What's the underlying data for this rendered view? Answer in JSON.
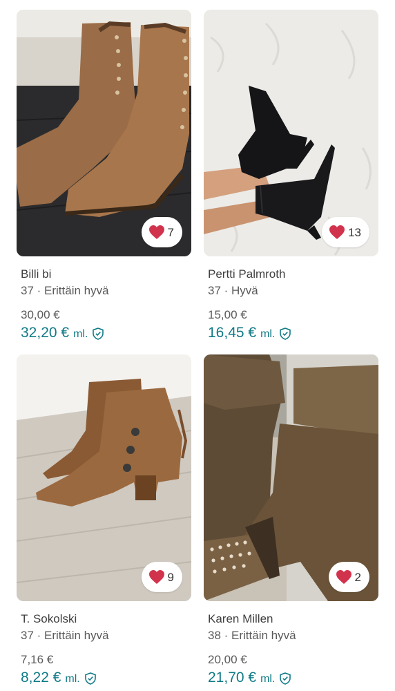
{
  "listings": [
    {
      "brand": "Billi bi",
      "size_condition": "37 · Erittäin hyvä",
      "price": "30,00 €",
      "total_price": "32,20 €",
      "total_suffix": "ml.",
      "favorites": "7",
      "image": "brown suede ankle boots with eyelet lacing"
    },
    {
      "brand": "Pertti Palmroth",
      "size_condition": "37 · Hyvä",
      "price": "15,00 €",
      "total_price": "16,45 €",
      "total_suffix": "ml.",
      "favorites": "13",
      "image": "black suede stiletto ankle boots worn on legs"
    },
    {
      "brand": "T. Sokolski",
      "size_condition": "37 · Erittäin hyvä",
      "price": "7,16 €",
      "total_price": "8,22 €",
      "total_suffix": "ml.",
      "favorites": "9",
      "image": "tan suede ankle boots with buttons"
    },
    {
      "brand": "Karen Millen",
      "size_condition": "38 · Erittäin hyvä",
      "price": "20,00 €",
      "total_price": "21,70 €",
      "total_suffix": "ml.",
      "favorites": "2",
      "image": "brown suede slouch boots with studded toe"
    }
  ],
  "colors": {
    "accent": "#0f7a86",
    "heart": "#d2334c"
  },
  "icons": {
    "favorite": "heart-icon",
    "buyer_protection": "shield-check-icon"
  }
}
